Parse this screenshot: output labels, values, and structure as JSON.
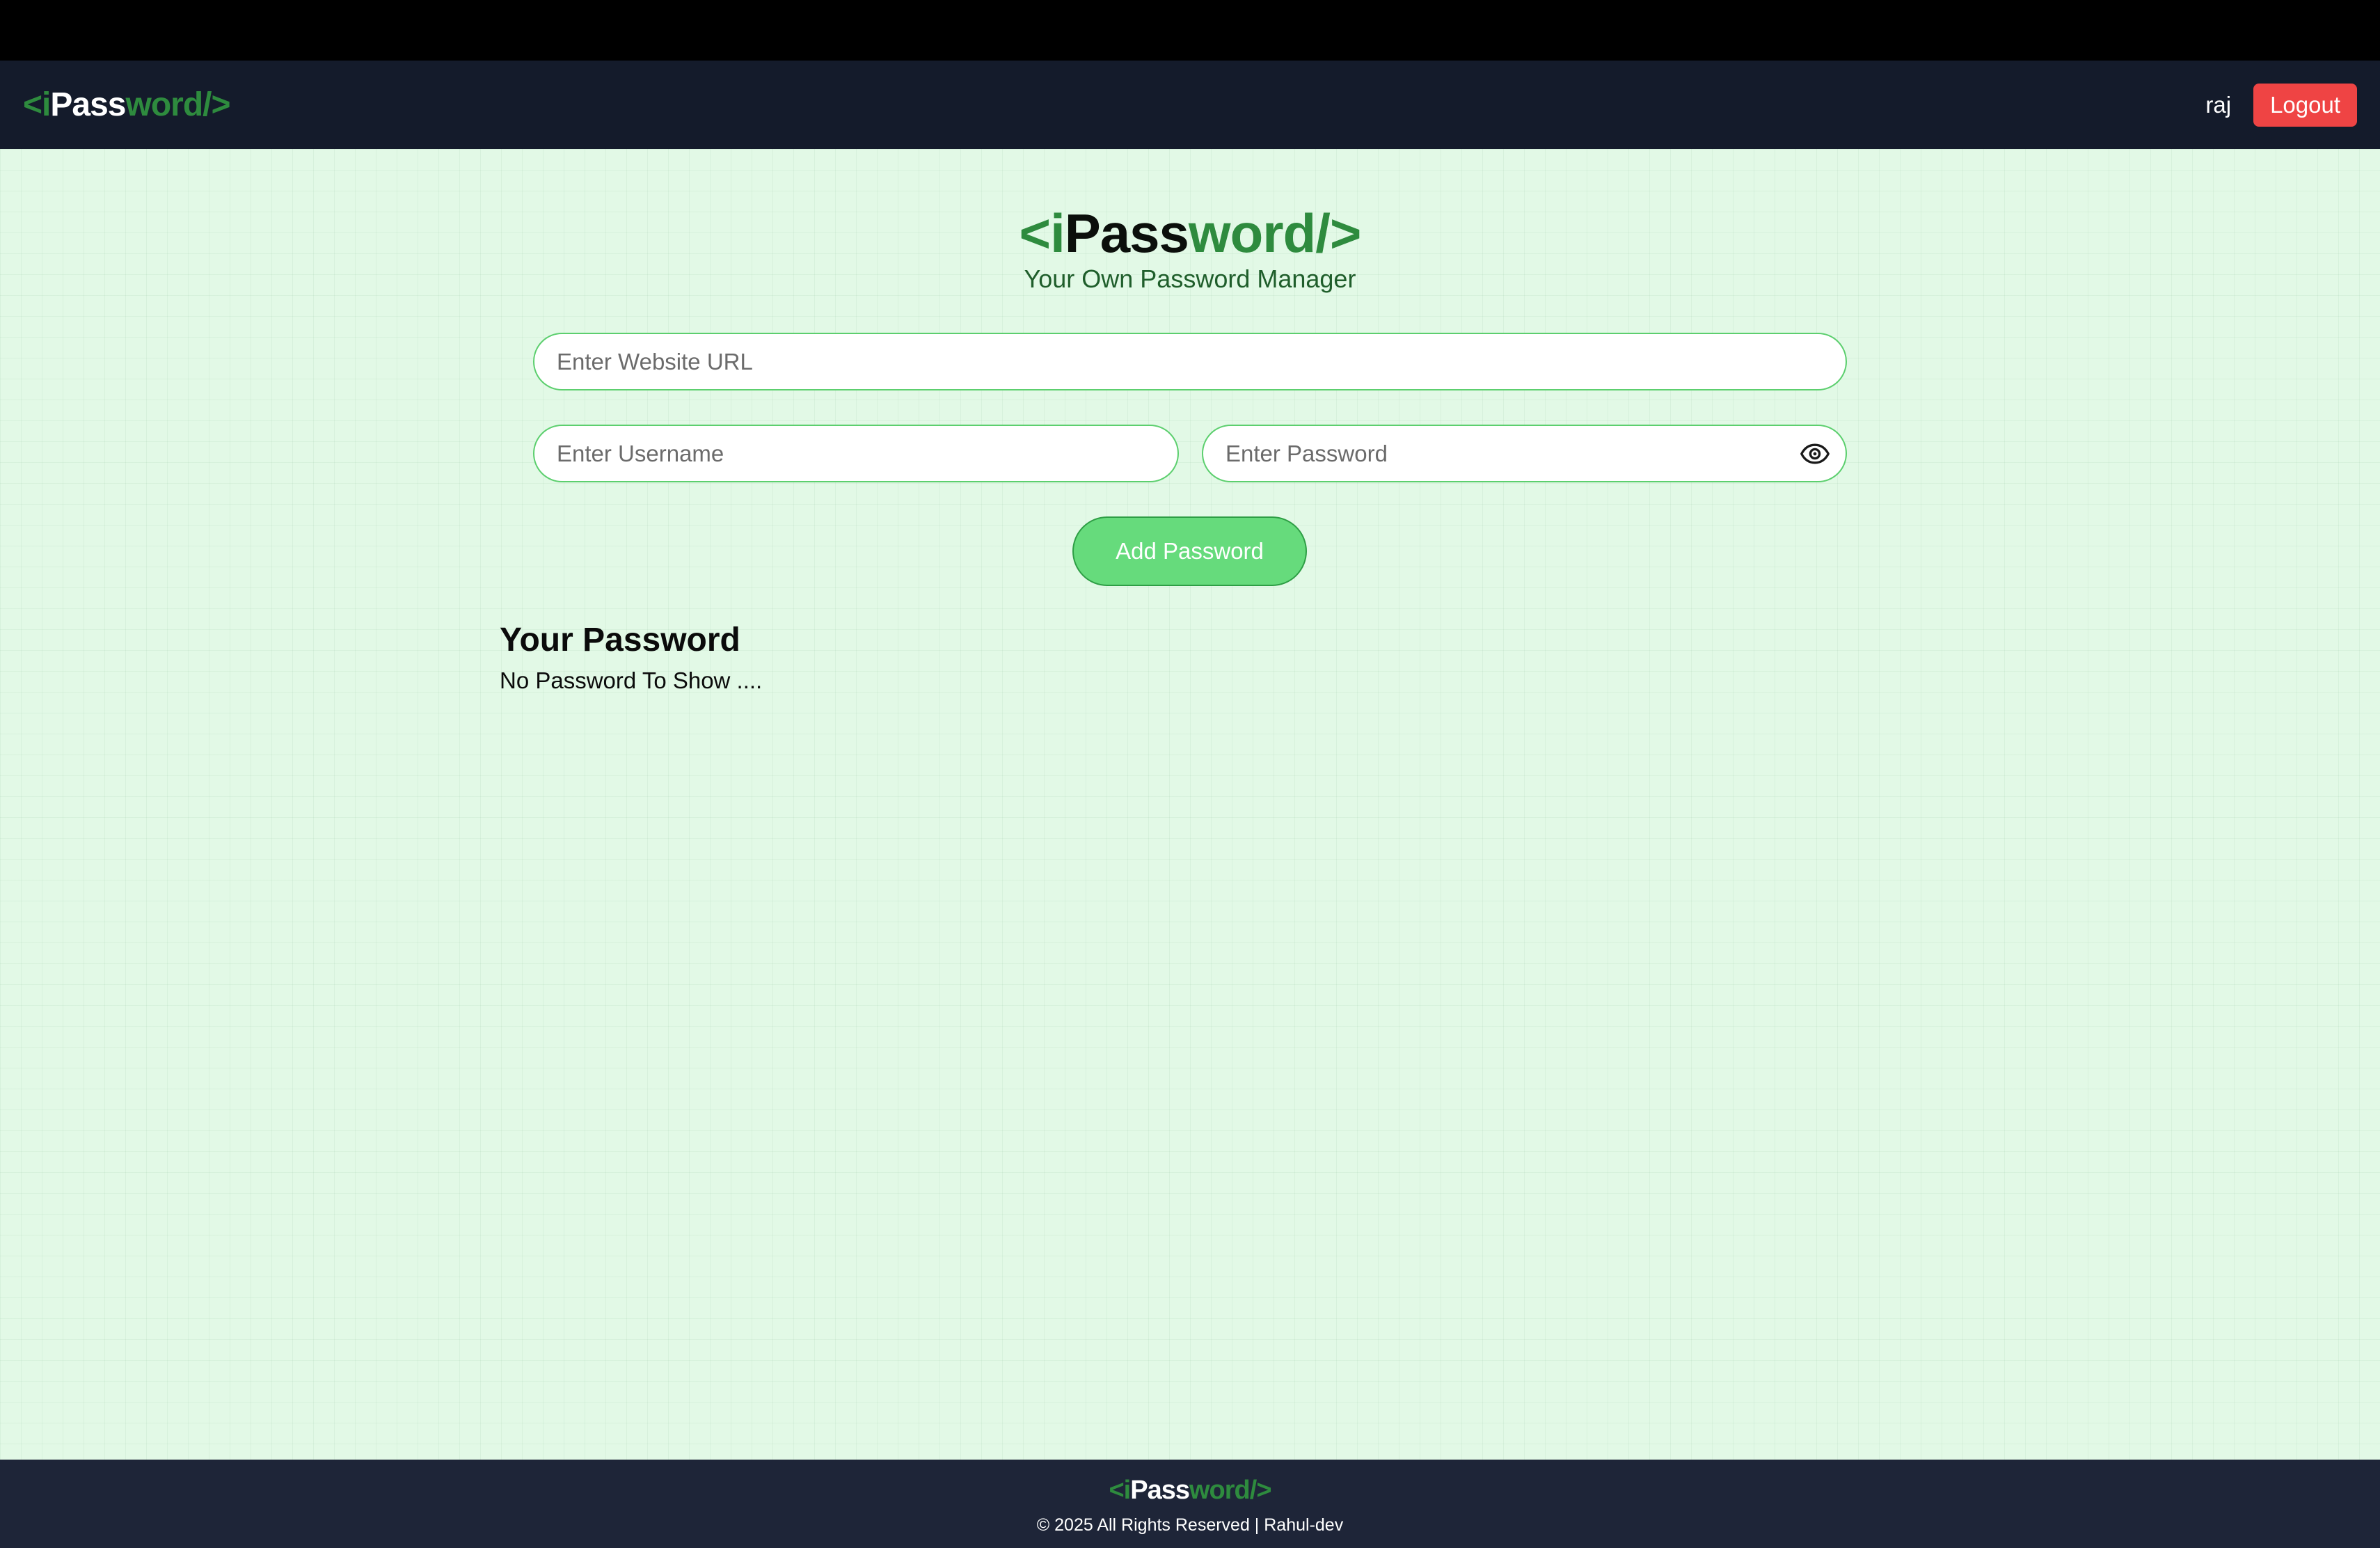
{
  "navbar": {
    "logo": {
      "open": "<",
      "i": "i",
      "pass": "Pass",
      "word": "word",
      "close": "/>"
    },
    "username": "raj",
    "logout_label": "Logout"
  },
  "hero": {
    "logo": {
      "open": "<",
      "i": "i",
      "pass": "Pass",
      "word": "word",
      "close": "/>"
    },
    "tagline": "Your Own Password Manager"
  },
  "form": {
    "url_placeholder": "Enter Website URL",
    "url_value": "",
    "username_placeholder": "Enter Username",
    "username_value": "",
    "password_placeholder": "Enter Password",
    "password_value": "",
    "show_password_icon": "eye-icon",
    "add_label": "Add Password"
  },
  "passwords": {
    "title": "Your Password",
    "empty_message": "No Password To Show ...."
  },
  "footer": {
    "logo": {
      "open": "<",
      "i": "i",
      "pass": "Pass",
      "word": "word",
      "close": "/>"
    },
    "copyright": "© 2025 All Rights Reserved | Rahul-dev"
  },
  "colors": {
    "brand_green": "#2e8b3e",
    "logout_red": "#ef4444",
    "button_green": "#66db7c",
    "navbar_bg": "#141b2b",
    "page_bg": "#e2f9e6"
  }
}
